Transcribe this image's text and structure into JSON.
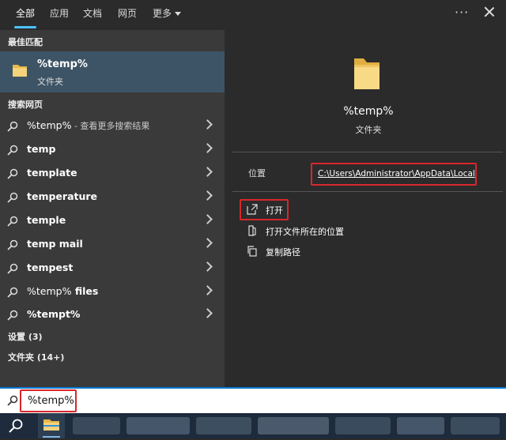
{
  "tabs": {
    "all": "全部",
    "apps": "应用",
    "docs": "文档",
    "web": "网页",
    "more": "更多"
  },
  "left": {
    "best_match_heading": "最佳匹配",
    "best_match": {
      "name": "%temp%",
      "type": "文件夹"
    },
    "web_heading": "搜索网页",
    "web_results": [
      {
        "bold": "%temp%",
        "hint": " - 查看更多搜索结果"
      },
      {
        "bold": "temp"
      },
      {
        "bold": "template"
      },
      {
        "bold": "temperature"
      },
      {
        "bold": "temple"
      },
      {
        "bold": "temp mail"
      },
      {
        "bold": "tempest"
      },
      {
        "lite": "%temp%",
        "bold": " files"
      },
      {
        "bold": "%tempt%"
      }
    ],
    "settings_heading": "设置 (3)",
    "folders_heading": "文件夹 (14+)"
  },
  "right": {
    "name": "%temp%",
    "type": "文件夹",
    "location_label": "位置",
    "location_path": "C:\\Users\\Administrator\\AppData\\Local",
    "actions": {
      "open": "打开",
      "open_location": "打开文件所在的位置",
      "copy_path": "复制路径"
    }
  },
  "search": {
    "value": "%temp%"
  },
  "colors": {
    "accent": "#4cc2ff",
    "highlight_box": "#d9262b",
    "selected_row": "#3d5466"
  }
}
